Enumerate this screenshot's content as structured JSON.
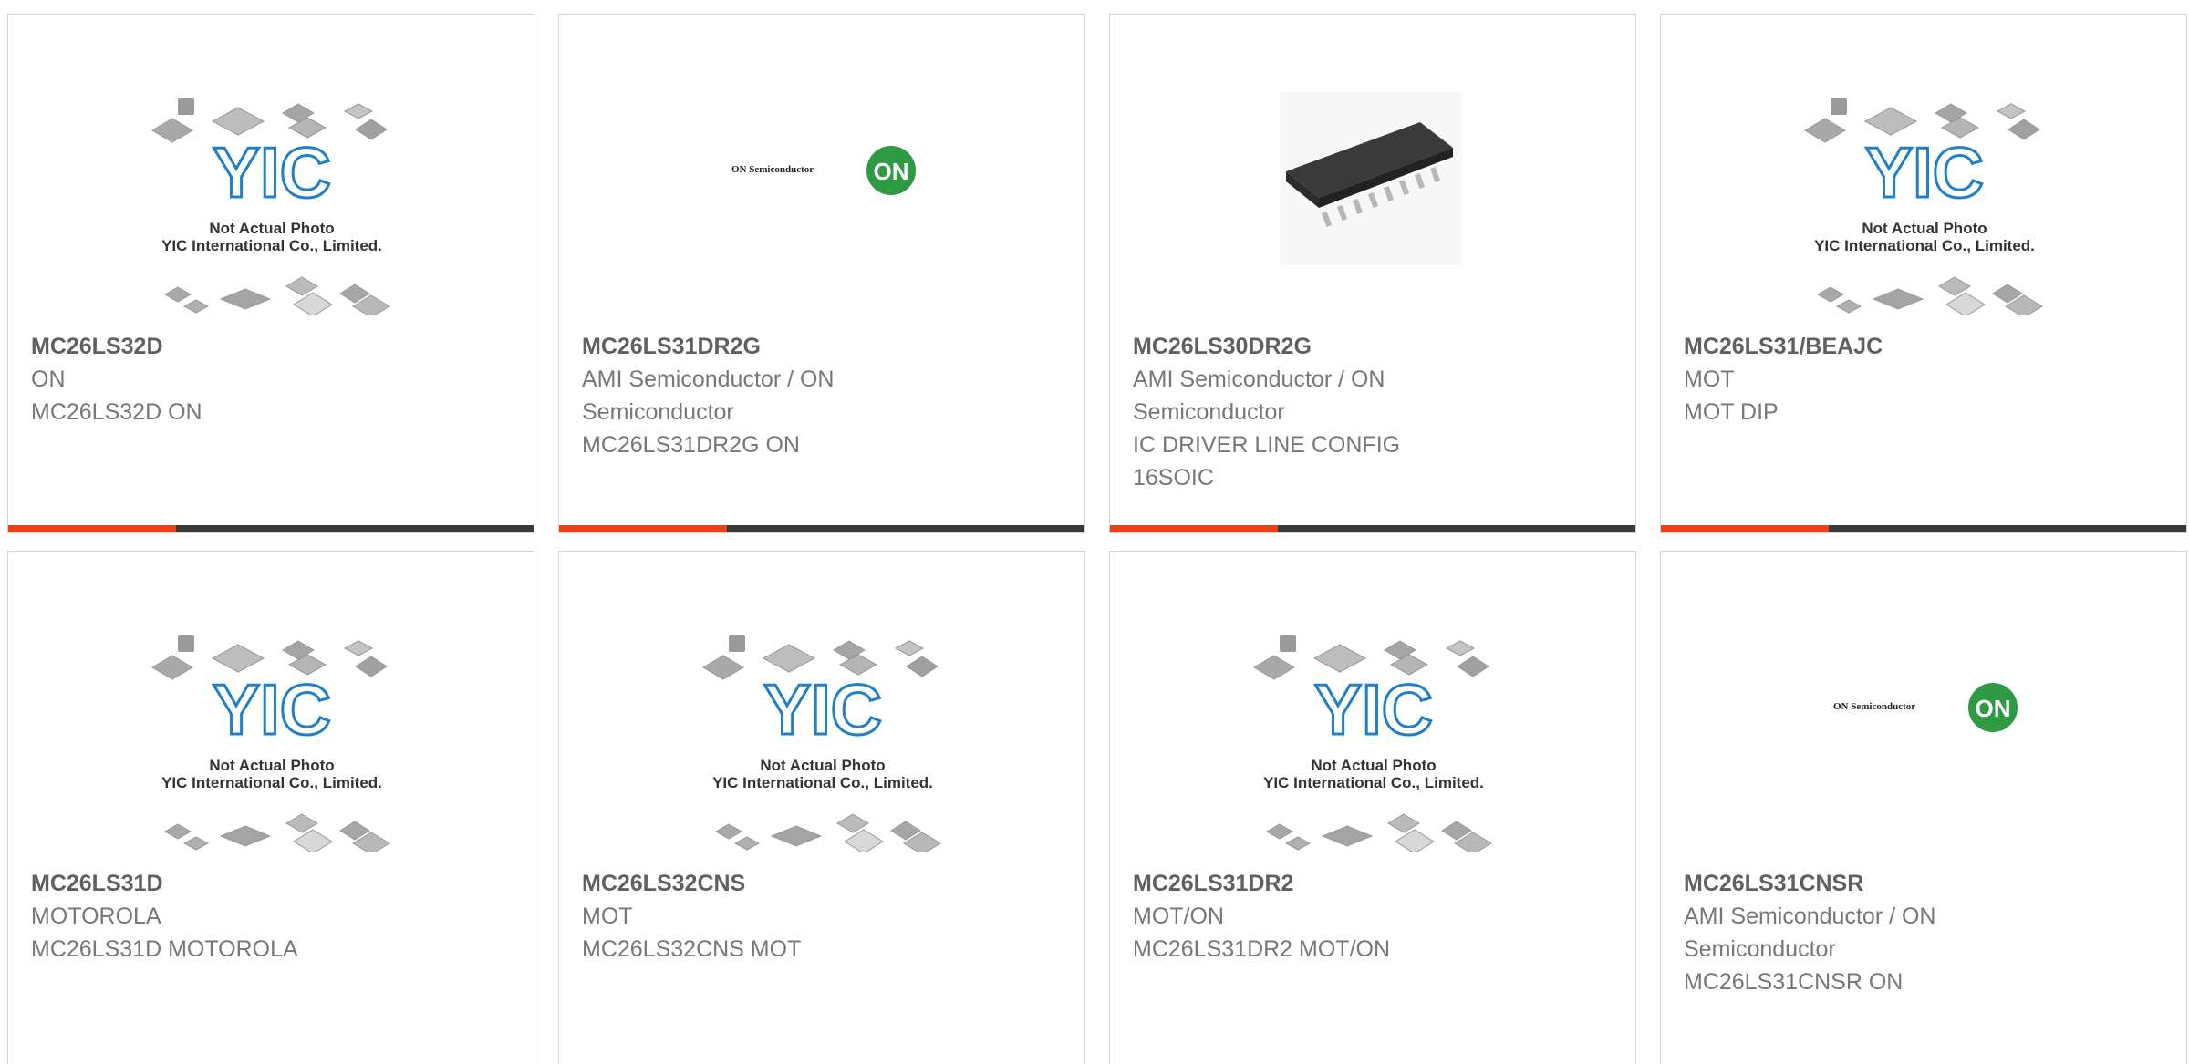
{
  "colors": {
    "accent": "#e8421b",
    "bar": "#3a3a3a",
    "border": "#d4d4d4",
    "yic_blue": "#1f7fc8",
    "on_green": "#2f9a44"
  },
  "placeholder": {
    "line1": "Not Actual Photo",
    "line2": "YIC International Co., Limited.",
    "logo": "YIC"
  },
  "on_logo": {
    "text": "ON Semiconductor",
    "badge": "ON"
  },
  "products": [
    {
      "part": "MC26LS32D",
      "lines": [
        "ON",
        "MC26LS32D ON"
      ],
      "image": "yic-placeholder"
    },
    {
      "part": "MC26LS31DR2G",
      "lines": [
        "AMI Semiconductor / ON",
        "Semiconductor",
        "MC26LS31DR2G ON"
      ],
      "image": "on-semiconductor-logo"
    },
    {
      "part": "MC26LS30DR2G",
      "lines": [
        "AMI Semiconductor / ON",
        "Semiconductor",
        "IC DRIVER LINE CONFIG",
        "16SOIC"
      ],
      "image": "soic-chip"
    },
    {
      "part": "MC26LS31/BEAJC",
      "lines": [
        "MOT",
        "MOT DIP"
      ],
      "image": "yic-placeholder"
    },
    {
      "part": "MC26LS31D",
      "lines": [
        "MOTOROLA",
        "MC26LS31D MOTOROLA"
      ],
      "image": "yic-placeholder"
    },
    {
      "part": "MC26LS32CNS",
      "lines": [
        "MOT",
        "MC26LS32CNS MOT"
      ],
      "image": "yic-placeholder"
    },
    {
      "part": "MC26LS31DR2",
      "lines": [
        "MOT/ON",
        "MC26LS31DR2 MOT/ON"
      ],
      "image": "yic-placeholder"
    },
    {
      "part": "MC26LS31CNSR",
      "lines": [
        "AMI Semiconductor / ON",
        "Semiconductor",
        "MC26LS31CNSR ON"
      ],
      "image": "on-semiconductor-logo"
    }
  ]
}
